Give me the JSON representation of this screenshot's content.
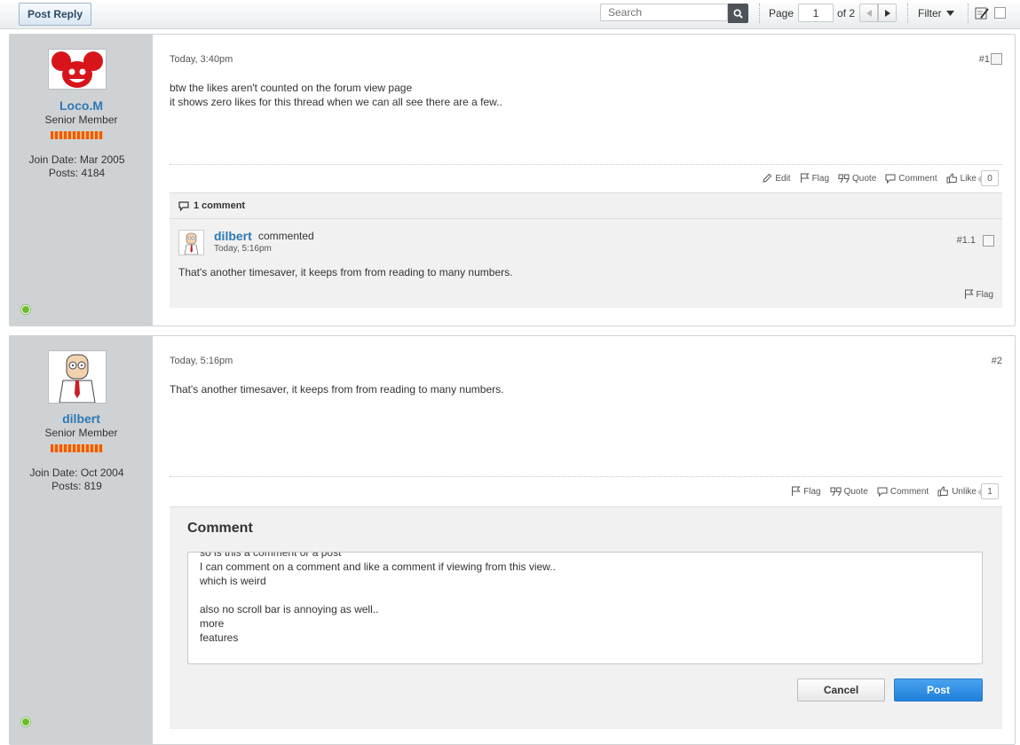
{
  "toolbar": {
    "post_reply_label": "Post Reply",
    "search_placeholder": "Search",
    "page_label": "Page",
    "page_value": "1",
    "of_label": "of 2",
    "filter_label": "Filter"
  },
  "posts": [
    {
      "username": "Loco.M",
      "user_title": "Senior Member",
      "join_date": "Join Date: Mar 2005",
      "post_count": "Posts: 4184",
      "timestamp": "Today, 3:40pm",
      "number": "#1",
      "text": "btw the likes aren't counted on the forum view page\nit shows zero likes for this thread when we can all see there are a few..",
      "actions": {
        "edit": "Edit",
        "flag": "Flag",
        "quote": "Quote",
        "comment": "Comment",
        "like": "Like"
      },
      "like_count": "0",
      "comments_header": "1 comment",
      "comment": {
        "username": "dilbert",
        "verb": "commented",
        "timestamp": "Today, 5:16pm",
        "number": "#1.1",
        "text": "That's another timesaver, it keeps from from reading to many numbers.",
        "flag": "Flag"
      }
    },
    {
      "username": "dilbert",
      "user_title": "Senior Member",
      "join_date": "Join Date: Oct 2004",
      "post_count": "Posts: 819",
      "timestamp": "Today, 5:16pm",
      "number": "#2",
      "text": "That's another timesaver, it keeps from from reading to many numbers.",
      "actions": {
        "flag": "Flag",
        "quote": "Quote",
        "comment": "Comment",
        "unlike": "Unlike"
      },
      "like_count": "1"
    }
  ],
  "comment_editor": {
    "title": "Comment",
    "content": "so is this a comment or a post\nI can comment on a comment and like a comment if viewing from this view..\nwhich is weird\n\nalso no scroll bar is annoying as well..\nmore\nfeatures",
    "cancel_label": "Cancel",
    "post_label": "Post"
  },
  "colors": {
    "link_blue": "#2d79b5",
    "primary_button": "#1f7fd9",
    "online": "#6cbb2a",
    "user_column": "#cfd2d5"
  }
}
